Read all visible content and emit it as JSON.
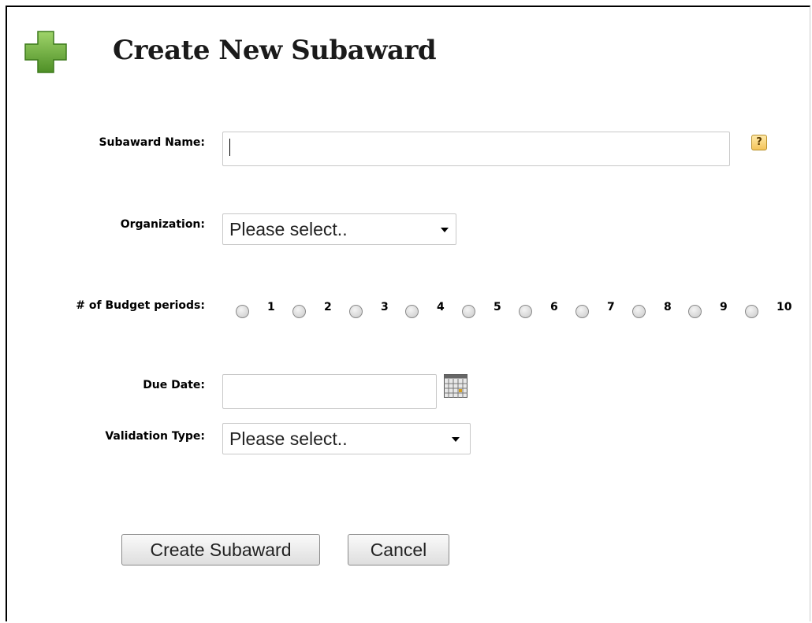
{
  "form": {
    "title": "Create New Subaward",
    "subaward_name": {
      "label": "Subaward Name:",
      "value": ""
    },
    "help_glyph": "?",
    "organization": {
      "label": "Organization:",
      "selected": "Please select.."
    },
    "budget_periods": {
      "label": "# of Budget periods:",
      "options": [
        "1",
        "2",
        "3",
        "4",
        "5",
        "6",
        "7",
        "8",
        "9",
        "10"
      ]
    },
    "due_date": {
      "label": "Due Date:",
      "value": ""
    },
    "validation_type": {
      "label": "Validation Type:",
      "selected": "Please select.."
    },
    "buttons": {
      "create": "Create Subaward",
      "cancel": "Cancel"
    }
  },
  "icons": {
    "title_icon": "green-plus-icon",
    "help": "help-icon",
    "calendar": "calendar-icon"
  },
  "colors": {
    "plus_green": "#6aa83a",
    "help_bg": "#f4c45a"
  }
}
